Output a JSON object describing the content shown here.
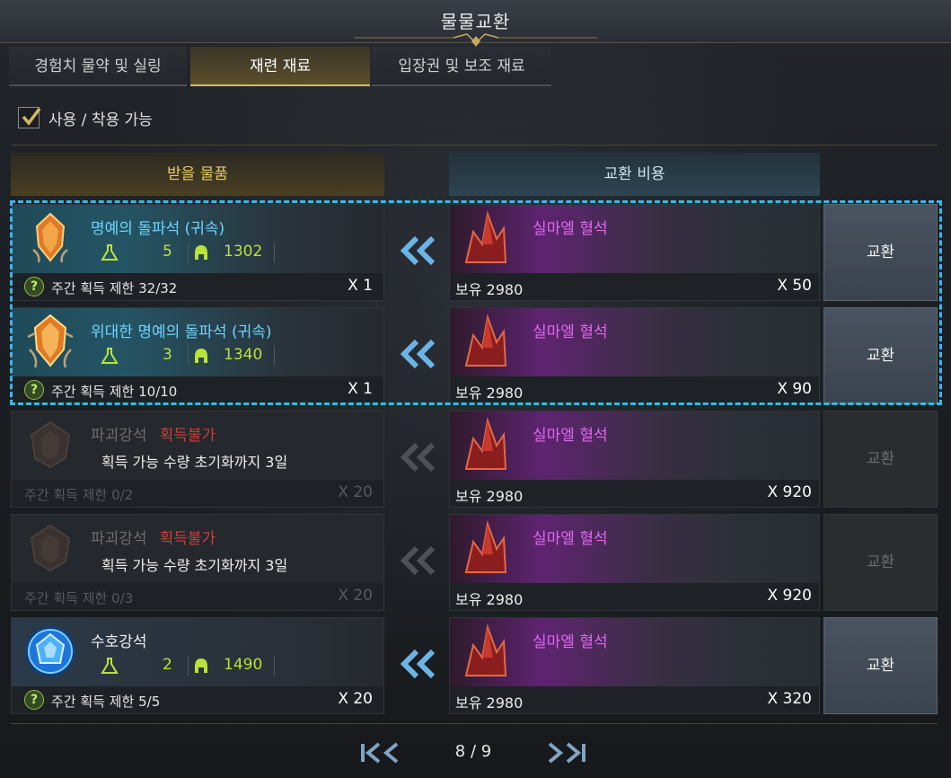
{
  "window": {
    "title": "물물교환"
  },
  "tabs": [
    {
      "label": "경험치 물약 및 실링",
      "active": false
    },
    {
      "label": "재련 재료",
      "active": true
    },
    {
      "label": "입장권 및 보조 재료",
      "active": false
    }
  ],
  "filter": {
    "label": "사용 / 착용 가능",
    "checked": true
  },
  "columns": {
    "receive": "받을 물품",
    "cost": "교환 비용"
  },
  "rows": [
    {
      "name": "명예의 돌파석 (귀속)",
      "unavailable": "",
      "note": "",
      "level": "5",
      "gearscore": "1302",
      "limit": "주간 획득 제한 32/32",
      "qty": "X 1",
      "cost_name": "실마엘 혈석",
      "owned": "보유 2980",
      "cost_qty": "X 50",
      "button": "교환",
      "enabled": true,
      "icon": "honor-leapstone-icon"
    },
    {
      "name": "위대한 명예의 돌파석 (귀속)",
      "unavailable": "",
      "note": "",
      "level": "3",
      "gearscore": "1340",
      "limit": "주간 획득 제한 10/10",
      "qty": "X 1",
      "cost_name": "실마엘 혈석",
      "owned": "보유 2980",
      "cost_qty": "X 90",
      "button": "교환",
      "enabled": true,
      "icon": "great-honor-leapstone-icon"
    },
    {
      "name": "파괴강석",
      "unavailable": "획득불가",
      "note": "획득 가능 수량 초기화까지 3일",
      "level": "",
      "gearscore": "",
      "limit": "주간 획득 제한 0/2",
      "qty": "X 20",
      "cost_name": "실마엘 혈석",
      "owned": "보유 2980",
      "cost_qty": "X 920",
      "button": "교환",
      "enabled": false,
      "icon": "destruction-stone-icon"
    },
    {
      "name": "파괴강석",
      "unavailable": "획득불가",
      "note": "획득 가능 수량 초기화까지 3일",
      "level": "",
      "gearscore": "",
      "limit": "주간 획득 제한 0/3",
      "qty": "X 20",
      "cost_name": "실마엘 혈석",
      "owned": "보유 2980",
      "cost_qty": "X 920",
      "button": "교환",
      "enabled": false,
      "icon": "destruction-stone-icon"
    },
    {
      "name": "수호강석",
      "unavailable": "",
      "note": "",
      "level": "2",
      "gearscore": "1490",
      "limit": "주간 획득 제한 5/5",
      "qty": "X 20",
      "cost_name": "실마엘 혈석",
      "owned": "보유 2980",
      "cost_qty": "X 320",
      "button": "교환",
      "enabled": true,
      "icon": "guardian-stone-icon"
    }
  ],
  "pager": {
    "text": "8 / 9"
  },
  "colors": {
    "accent_gold": "#d7b865",
    "item_blue": "#6fd3ff",
    "cost_purple": "#e066f0",
    "stat_green": "#b9e23a",
    "unavailable_red": "#c9403c",
    "selection": "#3cb6ec"
  }
}
